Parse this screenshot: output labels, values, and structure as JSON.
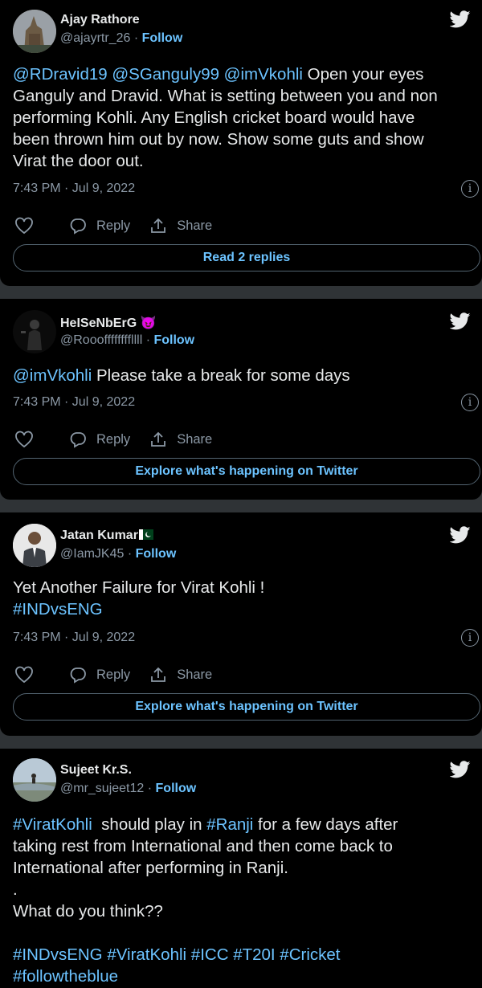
{
  "tweets": [
    {
      "name": "Ajay Rathore",
      "handle": "@ajayrtr_26",
      "follow": "Follow",
      "line1": "@RDravid19 @SGanguly99 @imVkohli Open your eyes",
      "line1_links": "@RDravid19 @SGanguly99 @imVkohli",
      "line1_rest": " Open your eyes",
      "line2": "Ganguly and Dravid. What is setting between you and non",
      "line3": "performing Kohli. Any English cricket board would have",
      "line4": "been thrown him out by now. Show some guts and show",
      "line5": "Virat the door out.",
      "time": "7:43 PM · Jul 9, 2022",
      "reply": "Reply",
      "share": "Share",
      "pill": "Read 2 replies"
    },
    {
      "name": "HeISeNbErG",
      "name_emoji": "😈",
      "handle": "@Roooffffffffllll",
      "follow": "Follow",
      "line1_link": "@imVkohli",
      "line1_rest": " Please take a break for some days",
      "time": "7:43 PM · Jul 9, 2022",
      "reply": "Reply",
      "share": "Share",
      "pill": "Explore what's happening on Twitter"
    },
    {
      "name": "Jatan Kumar",
      "handle": "@IamJK45",
      "follow": "Follow",
      "line1": "Yet Another Failure for Virat Kohli !",
      "line2_link": "#INDvsENG",
      "time": "7:43 PM · Jul 9, 2022",
      "reply": "Reply",
      "share": "Share",
      "pill": "Explore what's happening on Twitter"
    },
    {
      "name": "Sujeet Kr.S.",
      "handle": "@mr_sujeet12",
      "follow": "Follow",
      "l1_link1": "#ViratKohli",
      "l1_mid": "  should play in ",
      "l1_link2": "#Ranji",
      "l1_rest": " for a few days after",
      "line2": "taking rest from International and then come back to",
      "line3": "International after performing in Ranji.",
      "line4": ".",
      "line5": "What do you think??",
      "hashtags1": "#INDvsENG #ViratKohli #ICC #T20I #Cricket",
      "hashtags2": "#followtheblue"
    }
  ],
  "colors": {
    "link": "#6cc3ff",
    "muted": "#8b98a5",
    "card": "#000000",
    "separator": "#2f3336"
  }
}
